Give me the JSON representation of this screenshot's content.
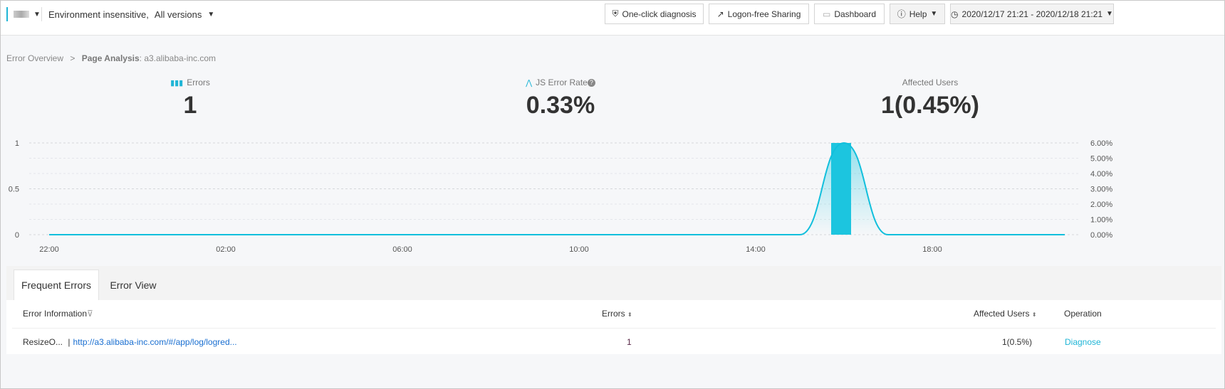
{
  "header": {
    "app_selector": "",
    "environment": "Environment insensitive,",
    "version": "All versions",
    "buttons": {
      "diagnosis": "One-click diagnosis",
      "sharing": "Logon-free Sharing",
      "dashboard": "Dashboard",
      "help": "Help",
      "time_range": "2020/12/17 21:21 - 2020/12/18 21:21"
    }
  },
  "breadcrumb": {
    "root": "Error Overview",
    "separator": ">",
    "current_label": "Page Analysis",
    "current_value": ": a3.alibaba-inc.com"
  },
  "kpis": [
    {
      "label": "Errors",
      "value": "1"
    },
    {
      "label": "JS Error Rate",
      "value": "0.33%"
    },
    {
      "label": "Affected Users",
      "value": "1(0.45%)"
    }
  ],
  "chart_data": {
    "type": "bar+area",
    "x": [
      "22:00",
      "23:00",
      "00:00",
      "01:00",
      "02:00",
      "03:00",
      "04:00",
      "05:00",
      "06:00",
      "07:00",
      "08:00",
      "09:00",
      "10:00",
      "11:00",
      "12:00",
      "13:00",
      "14:00",
      "15:00",
      "16:00",
      "17:00",
      "18:00",
      "19:00",
      "20:00",
      "21:00"
    ],
    "x_ticks": [
      "22:00",
      "02:00",
      "06:00",
      "10:00",
      "14:00",
      "18:00"
    ],
    "series": [
      {
        "name": "Errors",
        "type": "bar",
        "axis": "left",
        "values": [
          0,
          0,
          0,
          0,
          0,
          0,
          0,
          0,
          0,
          0,
          0,
          0,
          0,
          0,
          0,
          0,
          0,
          0,
          1,
          0,
          0,
          0,
          0,
          0
        ]
      },
      {
        "name": "JS Error Rate",
        "type": "area",
        "axis": "right",
        "values": [
          0,
          0,
          0,
          0,
          0,
          0,
          0,
          0,
          0,
          0,
          0,
          0,
          0,
          0,
          0,
          0,
          0,
          0,
          6,
          0,
          0,
          0,
          0,
          0
        ]
      }
    ],
    "left_ticks": [
      "0",
      "0.5",
      "1"
    ],
    "left_range": [
      0,
      1
    ],
    "right_ticks": [
      "0.00%",
      "1.00%",
      "2.00%",
      "3.00%",
      "4.00%",
      "5.00%",
      "6.00%"
    ],
    "right_range": [
      0,
      6
    ],
    "colors": {
      "bar": "#1cc5df",
      "line": "#11bfdc"
    }
  },
  "tabs": [
    {
      "label": "Frequent Errors"
    },
    {
      "label": "Error View"
    }
  ],
  "table": {
    "headers": {
      "info": "Error Information",
      "errors": "Errors",
      "users": "Affected Users",
      "operation": "Operation"
    },
    "rows": [
      {
        "name": "ResizeO...",
        "sep": "|",
        "url": "http://a3.alibaba-inc.com/#/app/log/logred...",
        "errors": "1",
        "users": "1(0.5%)",
        "action": "Diagnose"
      }
    ]
  }
}
